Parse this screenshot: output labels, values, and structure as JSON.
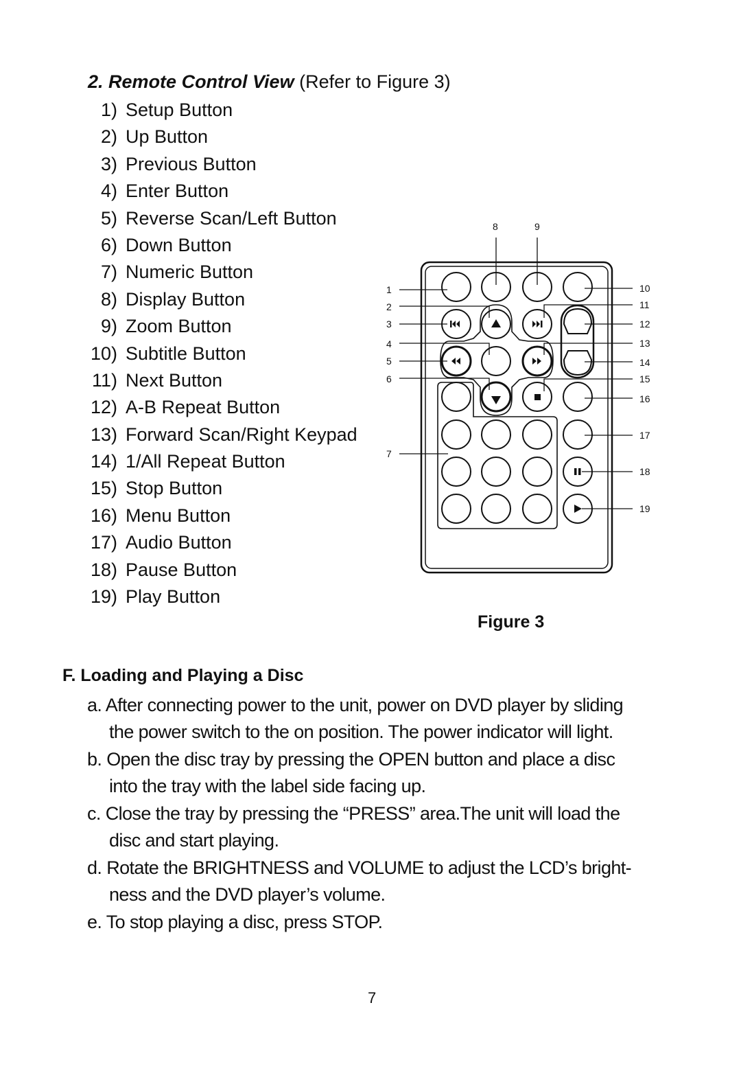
{
  "section": {
    "number": "2.",
    "title": "Remote Control View",
    "reference": "(Refer to Figure 3)"
  },
  "buttons": [
    {
      "num": "1)",
      "label": "Setup Button"
    },
    {
      "num": "2)",
      "label": "Up Button"
    },
    {
      "num": "3)",
      "label": "Previous Button"
    },
    {
      "num": "4)",
      "label": "Enter Button"
    },
    {
      "num": "5)",
      "label": "Reverse Scan/Left Button"
    },
    {
      "num": "6)",
      "label": "Down Button"
    },
    {
      "num": "7)",
      "label": "Numeric Button"
    },
    {
      "num": "8)",
      "label": "Display Button"
    },
    {
      "num": "9)",
      "label": "Zoom Button"
    },
    {
      "num": "10)",
      "label": "Subtitle Button"
    },
    {
      "num": "11)",
      "label": "Next Button"
    },
    {
      "num": "12)",
      "label": "A-B Repeat Button"
    },
    {
      "num": "13)",
      "label": "Forward Scan/Right Keypad"
    },
    {
      "num": "14)",
      "label": "1/All Repeat Button"
    },
    {
      "num": "15)",
      "label": "Stop Button"
    },
    {
      "num": "16)",
      "label": "Menu Button"
    },
    {
      "num": "17)",
      "label": "Audio Button"
    },
    {
      "num": "18)",
      "label": "Pause Button"
    },
    {
      "num": "19)",
      "label": "Play Button"
    }
  ],
  "figure": {
    "caption": "Figure 3",
    "callouts": [
      "1",
      "2",
      "3",
      "4",
      "5",
      "6",
      "7",
      "8",
      "9",
      "10",
      "11",
      "12",
      "13",
      "14",
      "15",
      "16",
      "17",
      "18",
      "19"
    ]
  },
  "loading": {
    "title": "F. Loading and Playing a Disc",
    "steps": [
      {
        "line1": "a. After connecting power to the unit, power on DVD player by sliding",
        "line2": "the power switch to the on position. The power indicator will light."
      },
      {
        "line1": "b. Open the disc tray by pressing the OPEN button and place a disc",
        "line2": "into the tray with the label side facing up."
      },
      {
        "line1": "c. Close the tray by pressing the “PRESS” area.The unit will load the",
        "line2": "disc and start playing."
      },
      {
        "line1": "d. Rotate the BRIGHTNESS and VOLUME to adjust  the LCD’s bright-",
        "line2": "ness and  the DVD player’s volume."
      },
      {
        "line1": "e. To stop playing a disc, press STOP.",
        "line2": ""
      }
    ]
  },
  "page_number": "7"
}
